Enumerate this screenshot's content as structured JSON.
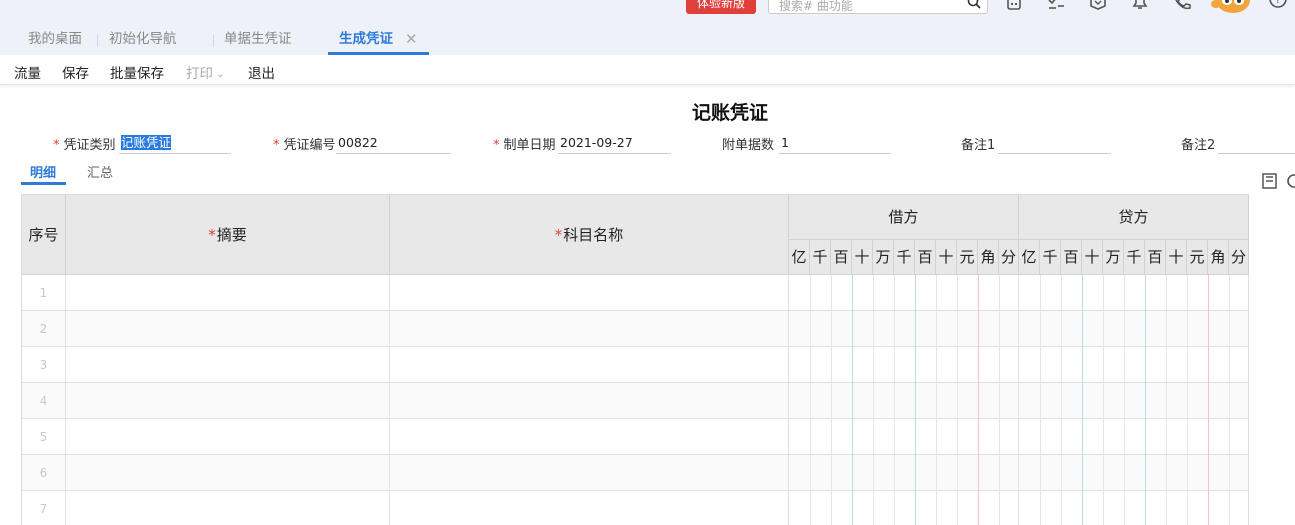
{
  "topbar": {
    "new_version_label": "体验新版",
    "search_placeholder": "搜索# 曲功能",
    "icons": [
      "calculator-icon",
      "checklist-icon",
      "box-icon",
      "bell-icon",
      "phone-icon",
      "mascot-avatar",
      "help-icon"
    ]
  },
  "tabs": [
    {
      "label": "我的桌面",
      "active": false
    },
    {
      "label": "初始化导航",
      "active": false
    },
    {
      "label": "单据生凭证",
      "active": false
    },
    {
      "label": "生成凭证",
      "active": true
    }
  ],
  "toolbar": {
    "flow": "流量",
    "save": "保存",
    "batch_save": "批量保存",
    "print": "打印",
    "exit": "退出"
  },
  "voucher": {
    "title": "记账凭证",
    "type_label": "凭证类别",
    "type_value": "记账凭证",
    "number_label": "凭证编号",
    "number_value": "00822",
    "date_label": "制单日期",
    "date_value": "2021-09-27",
    "attachments_label": "附单据数",
    "attachments_value": "1",
    "note1_label": "备注1",
    "note1_value": "",
    "note2_label": "备注2",
    "note2_value": ""
  },
  "subtabs": {
    "detail": "明细",
    "summary": "汇总"
  },
  "table": {
    "col_seq": "序号",
    "col_summary": "摘要",
    "col_account": "科目名称",
    "debit": "借方",
    "credit": "贷方",
    "digits": [
      "亿",
      "千",
      "百",
      "十",
      "万",
      "千",
      "百",
      "十",
      "元",
      "角",
      "分"
    ],
    "rows": [
      "1",
      "2",
      "3",
      "4",
      "5",
      "6",
      "7"
    ]
  },
  "colors": {
    "accent": "#2f7bd9",
    "danger": "#e0403a",
    "header_bg": "#e8e8e8"
  }
}
